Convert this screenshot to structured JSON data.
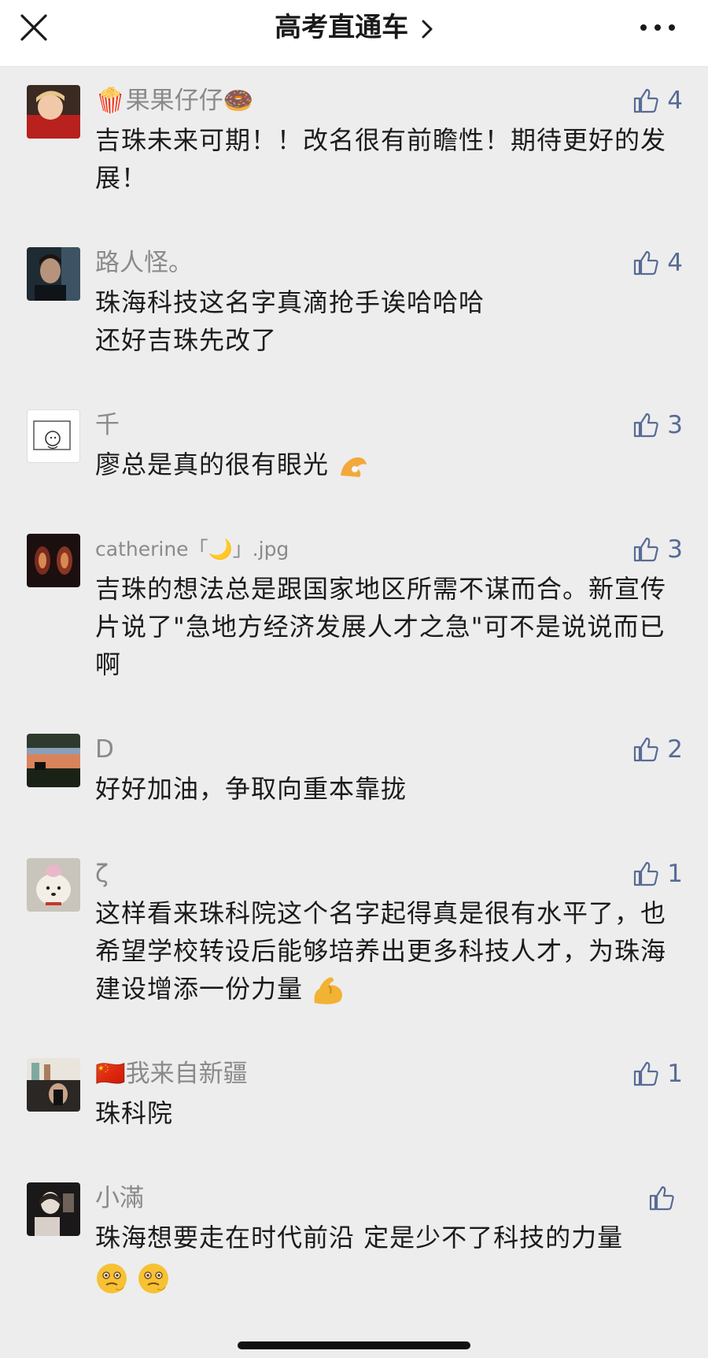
{
  "header": {
    "title": "高考直通车"
  },
  "comments": [
    {
      "nickname": "🍿果果仔仔🍩",
      "text": "吉珠未来可期！！改名很有前瞻性！期待更好的发展！",
      "likes": "4"
    },
    {
      "nickname": "路人怪。",
      "text_lines": [
        "珠海科技这名字真滴抢手诶哈哈哈",
        "还好吉珠先改了"
      ],
      "likes": "4"
    },
    {
      "nickname": "千",
      "text": "廖总是真的很有眼光",
      "likes": "3"
    },
    {
      "nickname": "catherine「🌙」.jpg",
      "text": "吉珠的想法总是跟国家地区所需不谋而合。新宣传片说了\"急地方经济发展人才之急\"可不是说说而已啊",
      "likes": "3"
    },
    {
      "nickname": "D",
      "text": "好好加油，争取向重本靠拢",
      "likes": "2"
    },
    {
      "nickname": "ζ",
      "text": "这样看来珠科院这个名字起得真是很有水平了，也希望学校转设后能够培养出更多科技人才，为珠海建设增添一份力量",
      "likes": "1"
    },
    {
      "nickname": "🇨🇳我来自新疆",
      "text": "珠科院",
      "likes": "1"
    },
    {
      "nickname": "小滿",
      "text": "珠海想要走在时代前沿 定是少不了科技的力量",
      "likes": ""
    }
  ],
  "colors": {
    "accent": "#576b95",
    "nickname": "#8a8a8a",
    "text": "#1b1b1b",
    "background": "#ededed"
  }
}
